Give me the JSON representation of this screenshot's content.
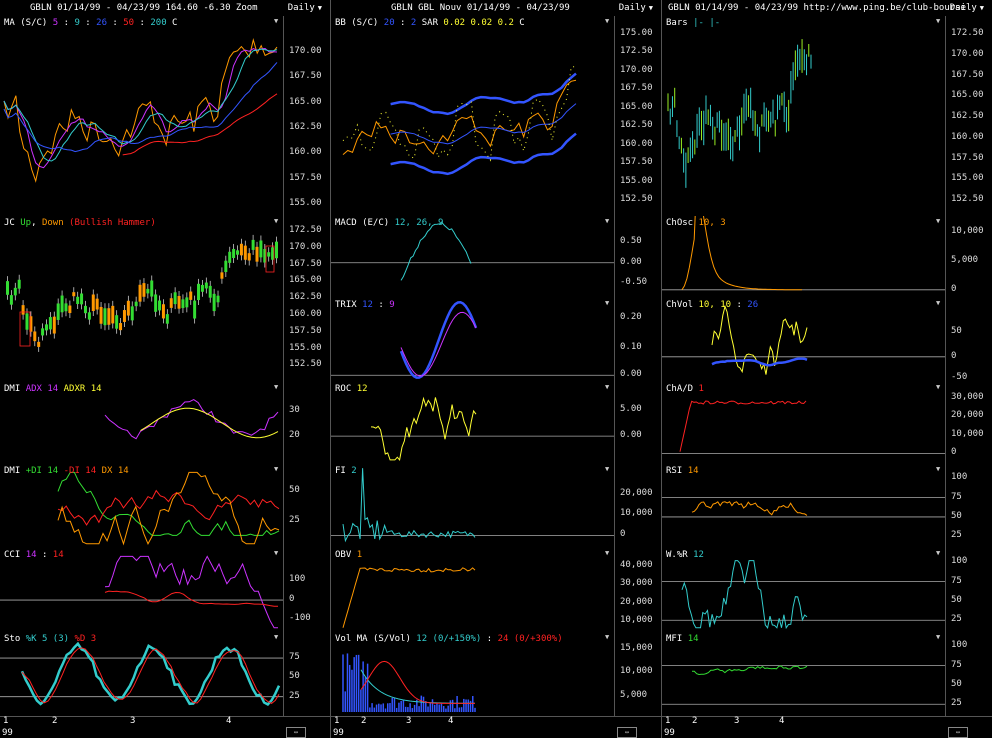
{
  "columns": [
    {
      "header": "GBLN  01/14/99 - 04/23/99     164.60   -6.30    Zoom",
      "period": "Daily"
    },
    {
      "header": "GBLN  GBL Nouv  01/14/99 - 04/23/99",
      "period": "Daily"
    },
    {
      "header": "GBLN  01/14/99 - 04/23/99    http://www.ping.be/club-bourse",
      "period": "Daily"
    }
  ],
  "colors": {
    "orange": "#ff9900",
    "magenta": "#cc33ff",
    "cyan": "#33cccc",
    "blue": "#3355ff",
    "yellow": "#ffff33",
    "red": "#ff2222",
    "green": "#33dd33",
    "lime": "#99ee22"
  },
  "panels": {
    "ma": {
      "label": [
        [
          "MA (S/C)  ",
          "#fff"
        ],
        [
          "5",
          "#cc33ff"
        ],
        [
          " : ",
          "#fff"
        ],
        [
          "9",
          "#33cccc"
        ],
        [
          " : ",
          "#fff"
        ],
        [
          "26",
          "#3355ff"
        ],
        [
          " : ",
          "#fff"
        ],
        [
          "50",
          "#ff2222"
        ],
        [
          " : ",
          "#fff"
        ],
        [
          "200",
          "#33cccc"
        ],
        [
          "    C ",
          "#fff"
        ]
      ],
      "ticks": [
        "170.00",
        "167.50",
        "165.00",
        "162.50",
        "160.00",
        "157.50",
        "155.00"
      ]
    },
    "jc": {
      "label": [
        [
          "JC ",
          "#fff"
        ],
        [
          "Up",
          "#33dd33"
        ],
        [
          ", ",
          "#fff"
        ],
        [
          "Down",
          "#ff9900"
        ],
        [
          "  (Bullish Hammer)",
          "#ff2222"
        ]
      ],
      "ticks": [
        "172.50",
        "170.00",
        "167.50",
        "165.00",
        "162.50",
        "160.00",
        "157.50",
        "155.00",
        "152.50"
      ]
    },
    "dmi1": {
      "label": [
        [
          "DMI  ",
          "#fff"
        ],
        [
          "ADX 14",
          "#cc33ff"
        ],
        [
          "  ",
          "#fff"
        ],
        [
          "ADXR 14",
          "#ffff33"
        ]
      ],
      "ticks": [
        "30",
        "20"
      ]
    },
    "dmi2": {
      "label": [
        [
          "DMI  ",
          "#fff"
        ],
        [
          "+DI 14",
          "#33dd33"
        ],
        [
          "  ",
          "#fff"
        ],
        [
          "-DI 14",
          "#ff2222"
        ],
        [
          "  ",
          "#fff"
        ],
        [
          "DX 14",
          "#ff9900"
        ]
      ],
      "ticks": [
        "50",
        "25"
      ]
    },
    "cci": {
      "label": [
        [
          "CCI  ",
          "#fff"
        ],
        [
          "14",
          "#cc33ff"
        ],
        [
          " : ",
          "#fff"
        ],
        [
          "14",
          "#ff2222"
        ]
      ],
      "ticks": [
        "100",
        "0",
        "-100"
      ]
    },
    "sto": {
      "label": [
        [
          "Sto  ",
          "#fff"
        ],
        [
          "%K 5 (3)",
          "#33cccc"
        ],
        [
          "  ",
          "#fff"
        ],
        [
          "%D 3",
          "#ff2222"
        ]
      ],
      "ticks": [
        "75",
        "50",
        "25"
      ]
    },
    "bb": {
      "label": [
        [
          "BB (S/C)  ",
          "#fff"
        ],
        [
          "20",
          "#3355ff"
        ],
        [
          " : ",
          "#fff"
        ],
        [
          "2",
          "#3355ff"
        ],
        [
          "    SAR  ",
          "#fff"
        ],
        [
          "0.02",
          "#ffff33"
        ],
        [
          "  ",
          "#fff"
        ],
        [
          "0.02",
          "#ffff33"
        ],
        [
          "  ",
          "#fff"
        ],
        [
          "0.2",
          "#ffff33"
        ],
        [
          "    C ",
          "#fff"
        ]
      ],
      "ticks": [
        "175.00",
        "172.50",
        "170.00",
        "167.50",
        "165.00",
        "162.50",
        "160.00",
        "157.50",
        "155.00",
        "152.50"
      ]
    },
    "macd": {
      "label": [
        [
          "MACD (E/C)  ",
          "#fff"
        ],
        [
          "12, 26, 9",
          "#33cccc"
        ]
      ],
      "ticks": [
        "0.50",
        "0.00",
        "-0.50"
      ]
    },
    "trix": {
      "label": [
        [
          "TRIX  ",
          "#fff"
        ],
        [
          "12",
          "#3355ff"
        ],
        [
          " : ",
          "#fff"
        ],
        [
          "9",
          "#cc33ff"
        ]
      ],
      "ticks": [
        "0.20",
        "0.10",
        "0.00"
      ]
    },
    "roc": {
      "label": [
        [
          "ROC  ",
          "#fff"
        ],
        [
          "12",
          "#ffff33"
        ]
      ],
      "ticks": [
        "5.00",
        "0.00"
      ]
    },
    "fi": {
      "label": [
        [
          "FI  ",
          "#fff"
        ],
        [
          "2",
          "#33cccc"
        ]
      ],
      "ticks": [
        "20,000",
        "10,000",
        "0"
      ]
    },
    "obv": {
      "label": [
        [
          "OBV  ",
          "#fff"
        ],
        [
          "1",
          "#ff9900"
        ]
      ],
      "ticks": [
        "40,000",
        "30,000",
        "20,000",
        "10,000"
      ]
    },
    "vol": {
      "label": [
        [
          "Vol    ",
          "#fff"
        ],
        [
          "MA  (S/Vol)   ",
          "#fff"
        ],
        [
          "12 (0/+150%)",
          "#33cccc"
        ],
        [
          " : ",
          "#fff"
        ],
        [
          "24 (0/+300%)",
          "#ff2222"
        ]
      ],
      "ticks": [
        "15,000",
        "10,000",
        "5,000"
      ]
    },
    "bars": {
      "label": [
        [
          "Bars  ",
          "#fff"
        ],
        [
          "|-",
          "#33cccc"
        ],
        [
          "  ",
          "#fff"
        ],
        [
          "|-",
          "#33cccc"
        ]
      ],
      "ticks": [
        "172.50",
        "170.00",
        "167.50",
        "165.00",
        "162.50",
        "160.00",
        "157.50",
        "155.00",
        "152.50"
      ]
    },
    "chosc": {
      "label": [
        [
          "ChOsc  ",
          "#fff"
        ],
        [
          "10, 3",
          "#ff9900"
        ]
      ],
      "ticks": [
        "10,000",
        "5,000",
        "0"
      ]
    },
    "chvol": {
      "label": [
        [
          "ChVol  ",
          "#fff"
        ],
        [
          "10, 10",
          "#ffff33"
        ],
        [
          " : ",
          "#fff"
        ],
        [
          "26",
          "#3355ff"
        ]
      ],
      "ticks": [
        "50",
        "0",
        "-50"
      ]
    },
    "chad": {
      "label": [
        [
          "ChA/D  ",
          "#fff"
        ],
        [
          "1",
          "#ff2222"
        ]
      ],
      "ticks": [
        "30,000",
        "20,000",
        "10,000",
        "0"
      ]
    },
    "rsi": {
      "label": [
        [
          "RSI  ",
          "#fff"
        ],
        [
          "14",
          "#ff9900"
        ]
      ],
      "ticks": [
        "100",
        "75",
        "50",
        "25"
      ]
    },
    "wr": {
      "label": [
        [
          "W.%R  ",
          "#fff"
        ],
        [
          "12",
          "#33cccc"
        ]
      ],
      "ticks": [
        "100",
        "75",
        "50",
        "25"
      ]
    },
    "mfi": {
      "label": [
        [
          "MFI  ",
          "#fff"
        ],
        [
          "14",
          "#33dd33"
        ]
      ],
      "ticks": [
        "100",
        "75",
        "50",
        "25"
      ]
    }
  },
  "axis": {
    "ticks": [
      "1",
      "2",
      "3",
      "4"
    ],
    "year": "99"
  }
}
